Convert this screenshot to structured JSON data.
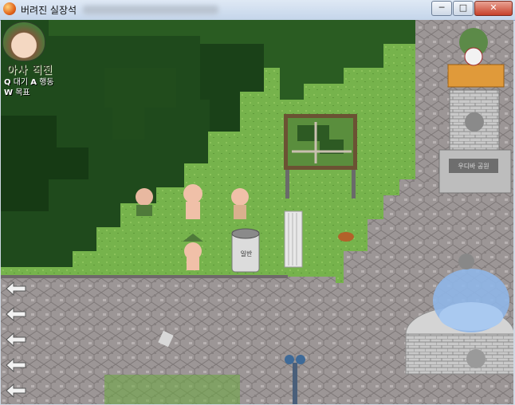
{
  "window": {
    "title": "버려진 실장석",
    "controls": [
      "─",
      "□",
      "✕"
    ]
  },
  "hud": {
    "status": "아사 직전",
    "key1": "Q",
    "action1": "대기",
    "key2": "A",
    "action2": "행동",
    "key3": "W",
    "action3": "목표"
  },
  "scene": {
    "trash_can_label": "일반",
    "monument_label": "우디바 공원"
  },
  "colors": {
    "grass": "#73b04a",
    "dark_foliage": "#244d1e",
    "pavement": "#9a9494",
    "water": "#8fb6e8",
    "titlebar": "#c4d5ea"
  },
  "icons": {
    "left_arrow": "arrow-left-icon",
    "app_icon": "orange-circle-icon",
    "portrait": "jissouseki-face"
  }
}
